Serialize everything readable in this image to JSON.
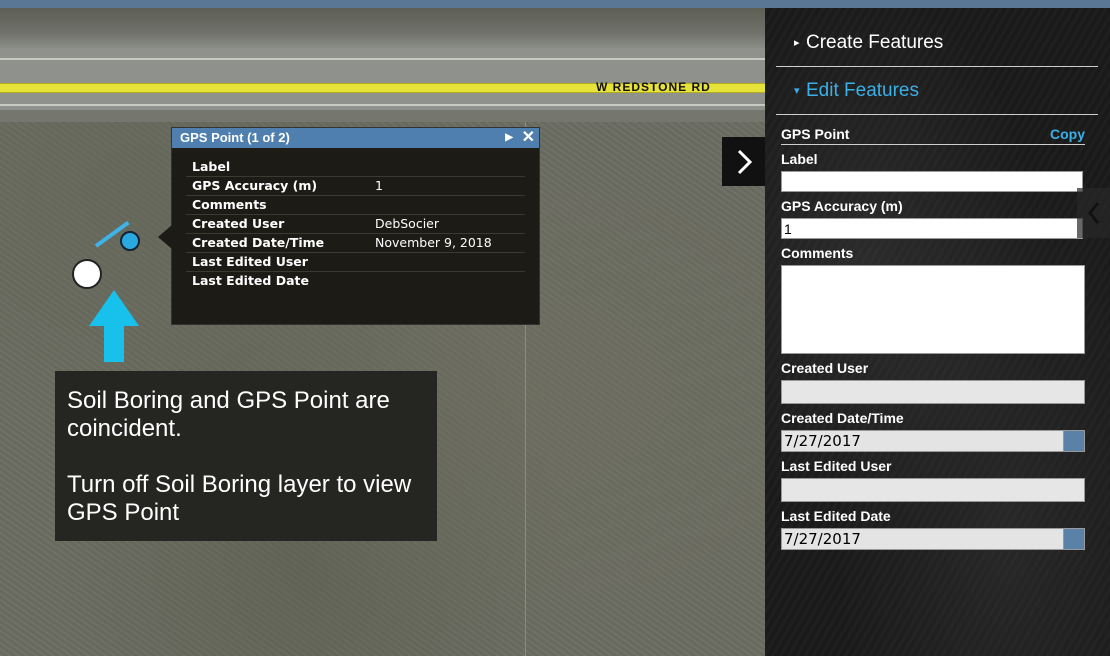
{
  "map": {
    "road_label": "W REDSTONE RD"
  },
  "popup": {
    "title": "GPS Point (1 of 2)",
    "next_icon": "play-icon",
    "close_icon": "close-icon",
    "rows": [
      {
        "key": "Label",
        "value": ""
      },
      {
        "key": "GPS Accuracy (m)",
        "value": "1"
      },
      {
        "key": "Comments",
        "value": ""
      },
      {
        "key": "Created User",
        "value": "DebSocier"
      },
      {
        "key": "Created Date/Time",
        "value": "November 9, 2018"
      },
      {
        "key": "Last Edited User",
        "value": ""
      },
      {
        "key": "Last Edited Date",
        "value": ""
      }
    ]
  },
  "callout": {
    "line1": "Soil Boring and GPS Point are coincident.",
    "line2": "Turn off Soil Boring layer to view GPS Point"
  },
  "panel": {
    "create_features": "Create Features",
    "edit_features": "Edit Features",
    "form_title": "GPS Point",
    "copy_label": "Copy",
    "fields": {
      "label": {
        "label": "Label",
        "value": ""
      },
      "gps_accuracy": {
        "label": "GPS Accuracy (m)",
        "value": "1"
      },
      "comments": {
        "label": "Comments",
        "value": ""
      },
      "created_user": {
        "label": "Created User",
        "value": ""
      },
      "created_date": {
        "label": "Created Date/Time",
        "value": "7/27/2017"
      },
      "last_edited_user": {
        "label": "Last Edited User",
        "value": ""
      },
      "last_edited_date": {
        "label": "Last Edited Date",
        "value": "7/27/2017"
      }
    }
  },
  "colors": {
    "accent": "#3ab0e8",
    "popup_header": "#4f7fae",
    "road_line": "#e7e23a",
    "arrow": "#18c0ec"
  }
}
